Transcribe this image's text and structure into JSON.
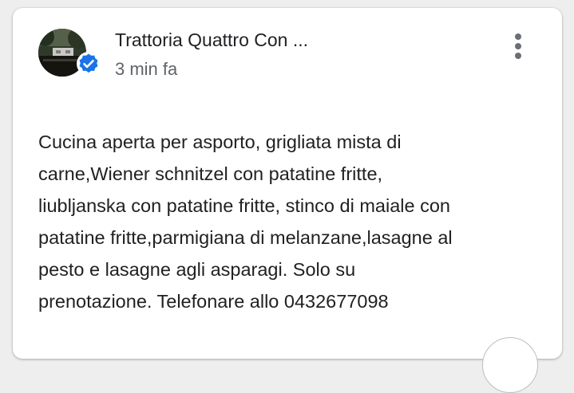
{
  "post": {
    "author": "Trattoria Quattro Con ...",
    "time": "3 min fa",
    "body_lines": [
      "Cucina aperta per asporto, grigliata mista di",
      "carne,Wiener schnitzel con patatine fritte,",
      "liubljanska con patatine fritte, stinco di maiale con",
      "patatine fritte,parmigiana di melanzane,lasagne al",
      "pesto e lasagne agli asparagi. Solo su",
      "prenotazione. Telefonare allo 0432677098"
    ]
  },
  "icons": {
    "verified": "verified-badge-icon",
    "more": "more-vert-icon"
  },
  "colors": {
    "verified_blue": "#1a73e8",
    "text_primary": "#202124",
    "text_secondary": "#5f6368"
  }
}
